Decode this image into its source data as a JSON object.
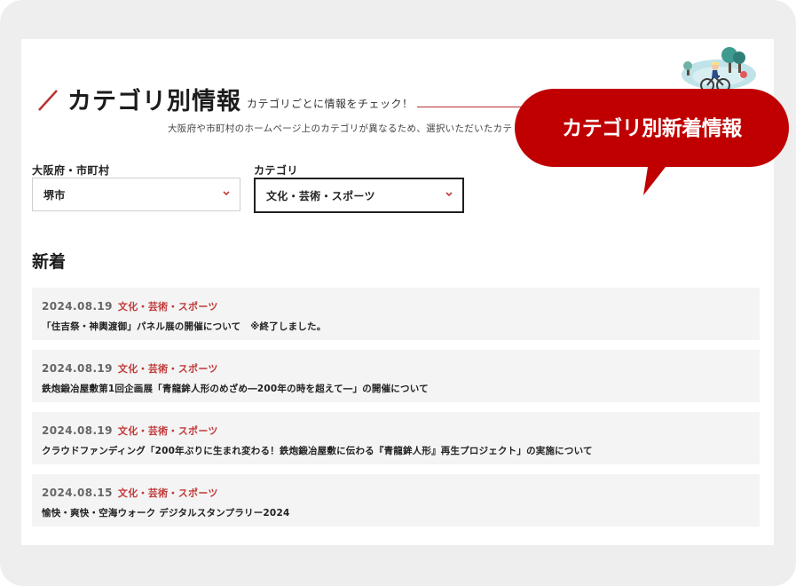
{
  "header": {
    "title": "カテゴリ別情報",
    "subtitle": "カテゴリごとに情報をチェック！",
    "description": "大阪府や市町村のホームページ上のカテゴリが異なるため、選択いただいたカテ"
  },
  "filters": {
    "area": {
      "label": "大阪府・市町村",
      "value": "堺市"
    },
    "category": {
      "label": "カテゴリ",
      "value": "文化・芸術・スポーツ"
    }
  },
  "news": {
    "heading": "新着",
    "items": [
      {
        "date": "2024.08.19",
        "category": "文化・芸術・スポーツ",
        "title": "「住吉祭・神輿渡御」パネル展の開催について　※終了しました。"
      },
      {
        "date": "2024.08.19",
        "category": "文化・芸術・スポーツ",
        "title": "鉄炮鍛冶屋敷第1回企画展「青龍鉾人形のめざめ―200年の時を超えて―」の開催について"
      },
      {
        "date": "2024.08.19",
        "category": "文化・芸術・スポーツ",
        "title": "クラウドファンディング「200年ぶりに生まれ変わる！鉄炮鍛冶屋敷に伝わる『青龍鉾人形』再生プロジェクト」の実施について"
      },
      {
        "date": "2024.08.15",
        "category": "文化・芸術・スポーツ",
        "title": "愉快・爽快・空海ウォーク デジタルスタンプラリー2024"
      }
    ]
  },
  "callout": {
    "text": "カテゴリ別新着情報"
  },
  "colors": {
    "accent": "#c00000",
    "category_text": "#c03a3a",
    "item_bg": "#f4f4f4"
  },
  "icons": {
    "heading_mark": "slash-icon",
    "select_arrow": "chevron-down-icon",
    "decoration": "cyclist-park-illustration"
  }
}
